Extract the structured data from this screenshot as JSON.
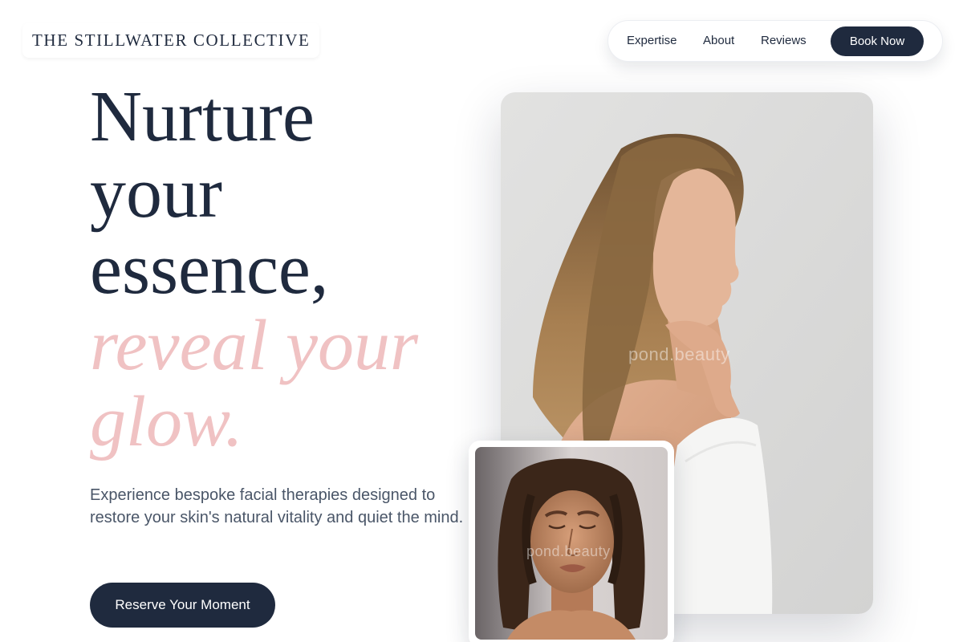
{
  "brand": {
    "name": "THE STILLWATER COLLECTIVE"
  },
  "nav": {
    "links": [
      {
        "label": "Expertise"
      },
      {
        "label": "About"
      },
      {
        "label": "Reviews"
      }
    ],
    "cta_label": "Book Now"
  },
  "hero": {
    "title_lines": [
      "Nurture",
      "your",
      "essence,"
    ],
    "title_accent_lines": [
      "reveal your",
      "glow."
    ],
    "subtitle": "Experience bespoke facial therapies designed to restore your skin's natural vitality and quiet the mind.",
    "cta_label": "Reserve Your Moment"
  },
  "images": {
    "main_watermark": "pond.beauty",
    "secondary_watermark": "pond.beauty"
  },
  "colors": {
    "navy": "#1f2a3e",
    "blush_accent": "#f0c2c3",
    "body_text": "#4a5668",
    "photo_background": "#dadad9"
  },
  "icons": []
}
